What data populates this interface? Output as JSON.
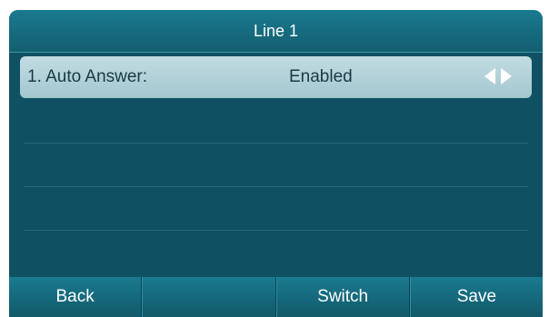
{
  "title": "Line 1",
  "rows": [
    {
      "label": "1. Auto Answer:",
      "value": "Enabled"
    }
  ],
  "icons": {
    "left": "triangle-left-icon",
    "right": "triangle-right-icon"
  },
  "softkeys": [
    "Back",
    "",
    "Switch",
    "Save"
  ],
  "colors": {
    "screen_bg": "#0f5163",
    "bar": "#1a7a8f",
    "selected_row": "#b3d1d8"
  }
}
